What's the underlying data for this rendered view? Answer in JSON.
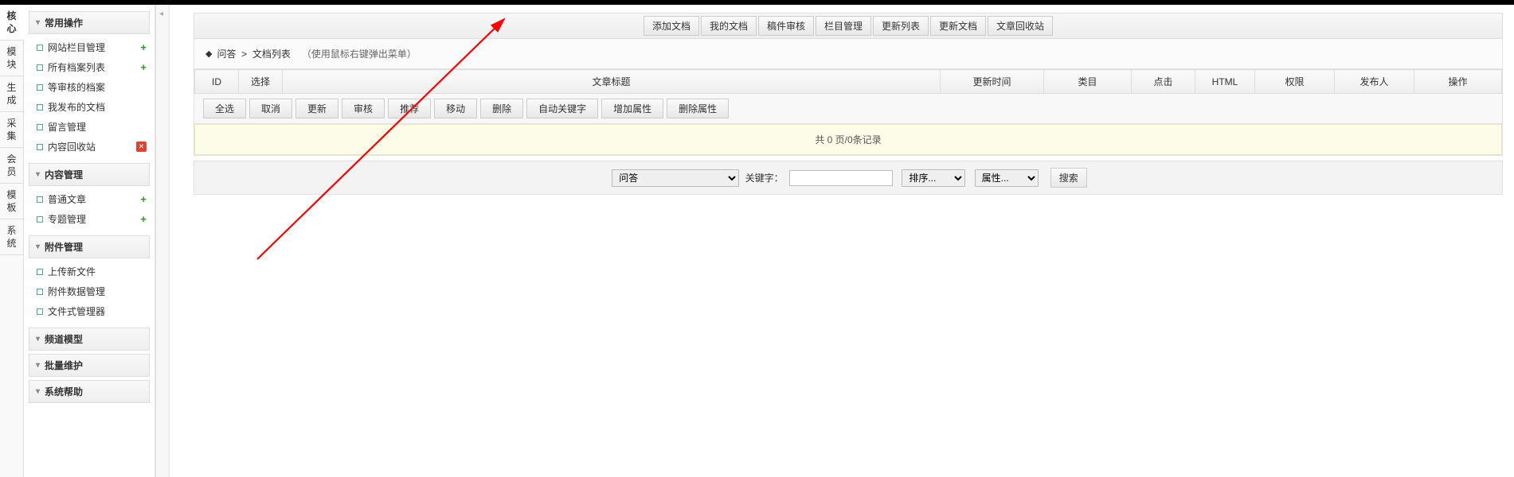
{
  "vtabs": [
    "核心",
    "模块",
    "生成",
    "采集",
    "会员",
    "模板",
    "系统"
  ],
  "sidebar": {
    "sections": [
      {
        "title": "常用操作",
        "items": [
          {
            "label": "网站栏目管理",
            "icon": "add"
          },
          {
            "label": "所有档案列表",
            "icon": "add"
          },
          {
            "label": "等审核的档案"
          },
          {
            "label": "我发布的文档"
          },
          {
            "label": "留言管理"
          },
          {
            "label": "内容回收站",
            "icon": "del"
          }
        ]
      },
      {
        "title": "内容管理",
        "items": [
          {
            "label": "普通文章",
            "icon": "add"
          },
          {
            "label": "专题管理",
            "icon": "add"
          }
        ]
      },
      {
        "title": "附件管理",
        "items": [
          {
            "label": "上传新文件"
          },
          {
            "label": "附件数据管理"
          },
          {
            "label": "文件式管理器"
          }
        ]
      },
      {
        "title": "频道模型"
      },
      {
        "title": "批量维护"
      },
      {
        "title": "系统帮助"
      }
    ]
  },
  "toolbar": [
    "添加文档",
    "我的文档",
    "稿件审核",
    "栏目管理",
    "更新列表",
    "更新文档",
    "文章回收站"
  ],
  "breadcrumb": {
    "a": "问答",
    "b": "文档列表",
    "hint": "（使用鼠标右键弹出菜单）"
  },
  "columns": [
    "ID",
    "选择",
    "文章标题",
    "更新时间",
    "类目",
    "点击",
    "HTML",
    "权限",
    "发布人",
    "操作"
  ],
  "actions": [
    "全选",
    "取消",
    "更新",
    "审核",
    "推荐",
    "移动",
    "删除",
    "自动关键字",
    "增加属性",
    "删除属性"
  ],
  "pager": "共  0  页/0条记录",
  "filter": {
    "cat_options": [
      "问答"
    ],
    "cat_value": "问答",
    "kw_label": "关键字：",
    "sort_options": [
      "排序..."
    ],
    "attr_options": [
      "属性..."
    ],
    "search": "搜索"
  }
}
